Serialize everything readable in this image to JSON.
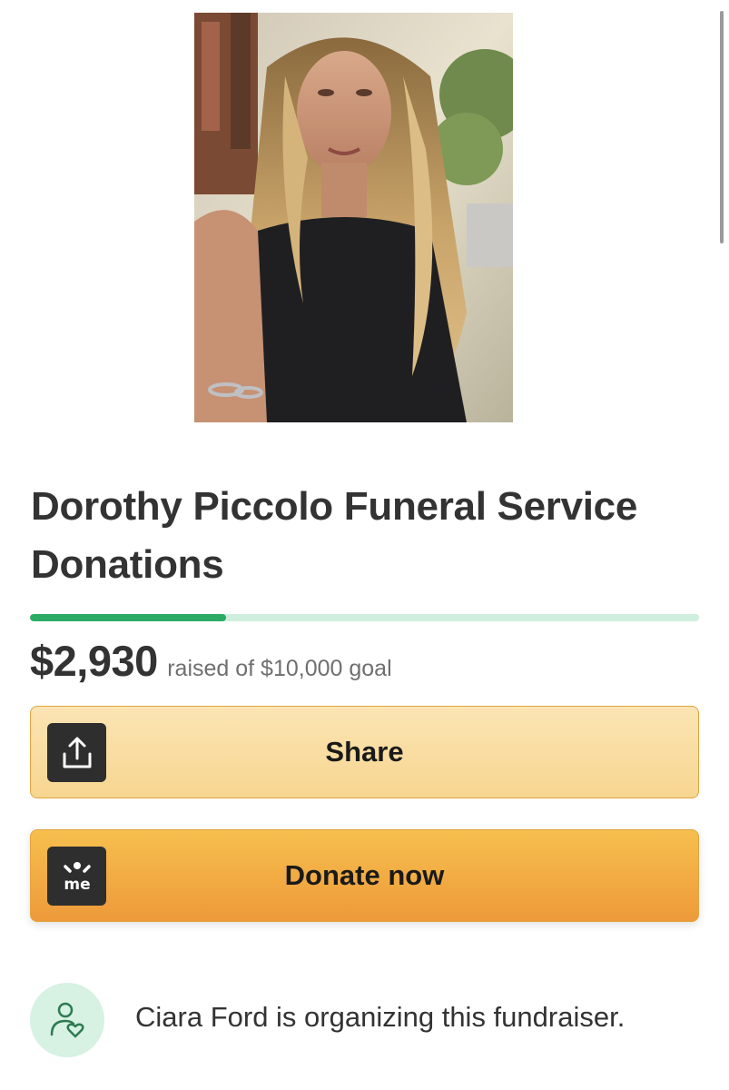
{
  "campaign": {
    "title": "Dorothy Piccolo Funeral Service Donations",
    "raised": "$2,930",
    "goal_text": "raised of $10,000 goal",
    "progress_fraction": 0.293,
    "photo_icon": "portrait-photo"
  },
  "actions": {
    "share_label": "Share",
    "share_icon": "share-upload-icon",
    "donate_label": "Donate now",
    "donate_icon": "gofundme-logo-icon"
  },
  "organizer": {
    "text": "Ciara Ford is organizing this fundraiser.",
    "icon": "user-heart-icon"
  },
  "colors": {
    "progress_fill": "#2bab64",
    "progress_track": "#cfeedd",
    "share_button": "#f8dc9d",
    "donate_button": "#f2ad44",
    "organizer_badge": "#d7f1e2"
  }
}
